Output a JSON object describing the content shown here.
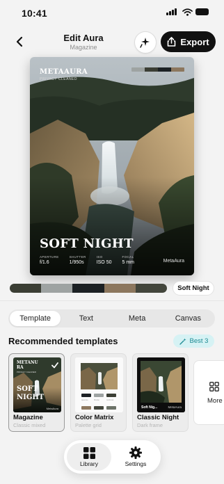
{
  "status": {
    "time": "10:41"
  },
  "header": {
    "title": "Edit Aura",
    "subtitle": "Magazine",
    "export_label": "Export"
  },
  "card": {
    "brand": "METAAURA",
    "brand_sub": "PRIVACY CLEANED",
    "headline": "SOFT NIGHT",
    "meta": [
      {
        "label": "APERTURE",
        "value": "f/1.6"
      },
      {
        "label": "SHUTTER",
        "value": "1/950s"
      },
      {
        "label": "ISO",
        "value": "ISO 50"
      },
      {
        "label": "FOCAL",
        "value": "5 mm"
      }
    ],
    "footer_brand": "MetaAura"
  },
  "palette": {
    "colors": [
      "#3b3e34",
      "#9ea3a2",
      "#1c2124",
      "#8c775e",
      "#43463c"
    ],
    "chip_label": "Soft Night"
  },
  "tabs": [
    {
      "label": "Template",
      "active": true
    },
    {
      "label": "Text",
      "active": false
    },
    {
      "label": "Meta",
      "active": false
    },
    {
      "label": "Canvas",
      "active": false
    }
  ],
  "recommended": {
    "title": "Recommended templates",
    "badge": "Best 3",
    "items": [
      {
        "name": "Magazine",
        "desc": "Classic mixed",
        "selected": true,
        "thumb_brand": "METANU RA",
        "thumb_sub": "PRIVACY CLEANED",
        "thumb_headline": "SOFT NIGHT",
        "thumb_footer": "MetaAura"
      },
      {
        "name": "Color Matrix",
        "desc": "Palette grid",
        "selected": false,
        "thumb_labels": [
          "Aperture",
          "Shutter",
          "Iso/Focal"
        ]
      },
      {
        "name": "Classic Night",
        "desc": "Dark frame",
        "selected": false,
        "thumb_left": "Soft Nig...",
        "thumb_right": "MetaAura"
      }
    ],
    "more_label": "More"
  },
  "bottom_nav": [
    {
      "label": "Library",
      "icon": "grid-icon",
      "active": true
    },
    {
      "label": "Settings",
      "icon": "gear-icon",
      "active": false
    }
  ]
}
